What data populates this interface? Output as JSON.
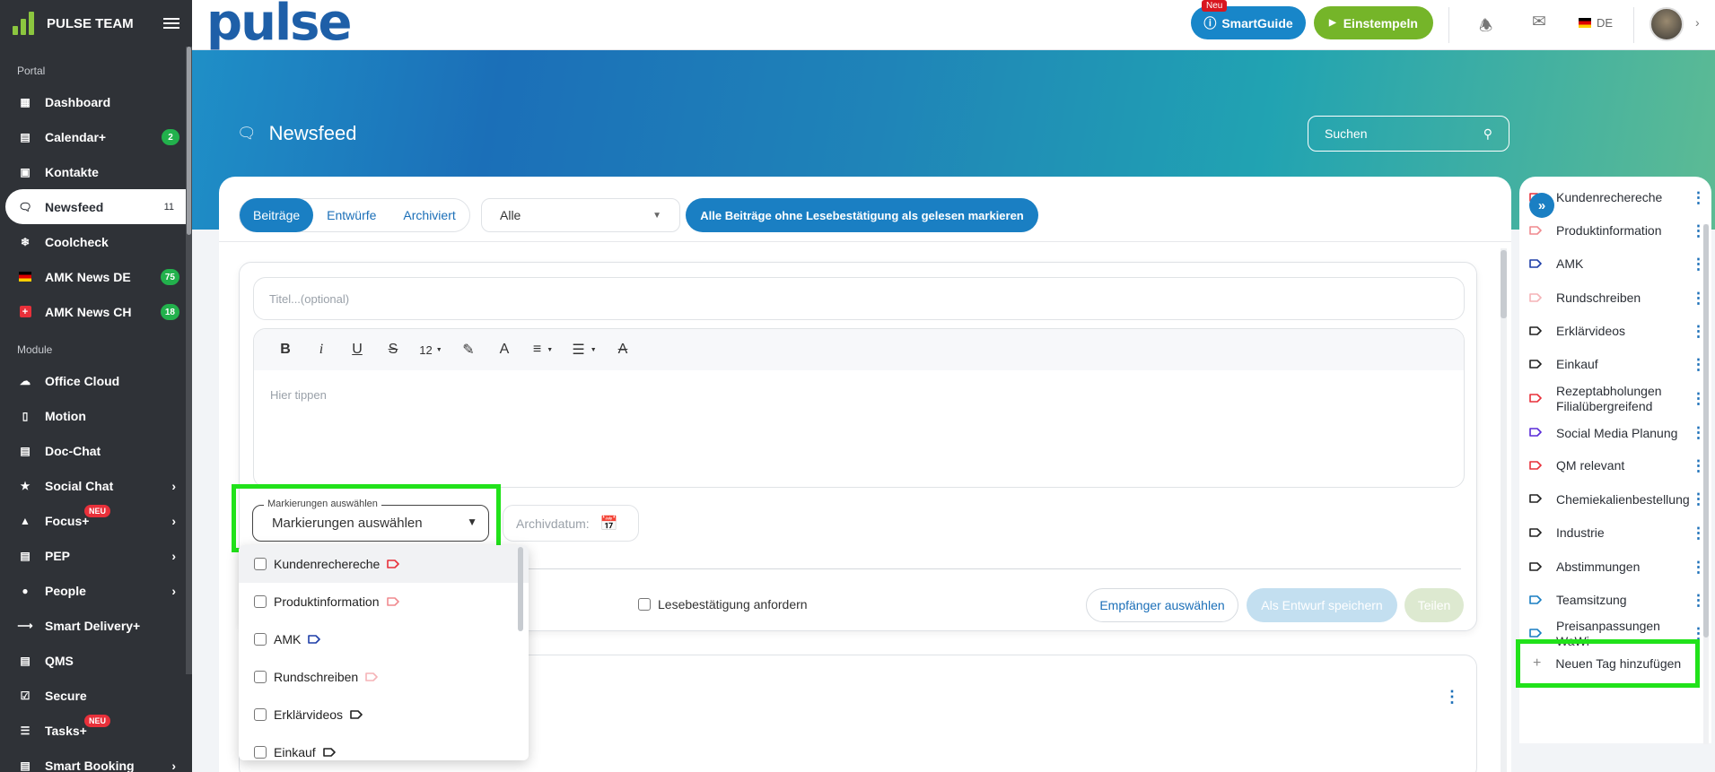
{
  "sidebar": {
    "title": "PULSE TEAM",
    "section_portal": "Portal",
    "section_module": "Module",
    "items_portal": [
      {
        "label": "Dashboard",
        "icon": "dashboard-icon"
      },
      {
        "label": "Calendar+",
        "icon": "calendar-icon",
        "badge": "2"
      },
      {
        "label": "Kontakte",
        "icon": "contacts-icon"
      },
      {
        "label": "Newsfeed",
        "icon": "newsfeed-icon",
        "count": "11",
        "active": true
      },
      {
        "label": "Coolcheck",
        "icon": "snowflake-icon"
      },
      {
        "label": "AMK News DE",
        "icon": "flag-de-icon",
        "badge": "75"
      },
      {
        "label": "AMK News CH",
        "icon": "flag-ch-icon",
        "badge": "18"
      }
    ],
    "items_module": [
      {
        "label": "Office Cloud",
        "icon": "cloud-icon"
      },
      {
        "label": "Motion",
        "icon": "phone-icon"
      },
      {
        "label": "Doc-Chat",
        "icon": "chat-icon"
      },
      {
        "label": "Social Chat",
        "icon": "share-icon",
        "chevron": true
      },
      {
        "label": "Focus+",
        "icon": "graduation-icon",
        "chevron": true,
        "neu": "NEU"
      },
      {
        "label": "PEP",
        "icon": "clipboard-icon",
        "chevron": true
      },
      {
        "label": "People",
        "icon": "people-icon",
        "chevron": true
      },
      {
        "label": "Smart Delivery+",
        "icon": "arrow-right-icon"
      },
      {
        "label": "QMS",
        "icon": "qms-icon"
      },
      {
        "label": "Secure",
        "icon": "check-square-icon"
      },
      {
        "label": "Tasks+",
        "icon": "list-icon",
        "neu": "NEU"
      },
      {
        "label": "Smart Booking",
        "icon": "booking-icon",
        "chevron": true
      }
    ]
  },
  "topbar": {
    "brand": "pulse",
    "smartguide": "SmartGuide",
    "neu": "Neu",
    "einstempeln": "Einstempeln",
    "lang": "DE"
  },
  "hero": {
    "title": "Newsfeed",
    "search_placeholder": "Suchen"
  },
  "main": {
    "tabs": [
      "Beiträge",
      "Entwürfe",
      "Archiviert"
    ],
    "filter_value": "Alle",
    "mark_read_button": "Alle Beiträge ohne Lesebestätigung als gelesen markieren",
    "title_placeholder": "Titel...(optional)",
    "font_size": "12",
    "editor_placeholder": "Hier tippen",
    "tag_select_label": "Markierungen auswählen",
    "tag_select_value": "Markierungen auswählen",
    "archive_label": "Archivdatum:",
    "read_receipt": "Lesebestätigung anfordern",
    "recipients_button": "Empfänger auswählen",
    "draft_button": "Als Entwurf speichern",
    "share_button": "Teilen"
  },
  "dropdown": [
    {
      "label": "Kundenrechereche",
      "color": "#e8303a"
    },
    {
      "label": "Produktinformation",
      "color": "#f08a8f"
    },
    {
      "label": "AMK",
      "color": "#1e3fa8"
    },
    {
      "label": "Rundschreiben",
      "color": "#f5b3b7"
    },
    {
      "label": "Erklärvideos",
      "color": "#222222"
    },
    {
      "label": "Einkauf",
      "color": "#222222"
    }
  ],
  "right_panel": {
    "tags": [
      {
        "label": "Kundenrechereche",
        "color": "#e8303a"
      },
      {
        "label": "Produktinformation",
        "color": "#f08a8f"
      },
      {
        "label": "AMK",
        "color": "#1e3fa8"
      },
      {
        "label": "Rundschreiben",
        "color": "#f5b3b7"
      },
      {
        "label": "Erklärvideos",
        "color": "#222222"
      },
      {
        "label": "Einkauf",
        "color": "#222222"
      },
      {
        "label": "Rezeptabholungen Filialübergreifend",
        "color": "#e8303a"
      },
      {
        "label": "Social Media Planung",
        "color": "#5a2bd8"
      },
      {
        "label": "QM relevant",
        "color": "#e8303a"
      },
      {
        "label": "Chemiekalienbestellung",
        "color": "#222222"
      },
      {
        "label": "Industrie",
        "color": "#222222"
      },
      {
        "label": "Abstimmungen",
        "color": "#222222"
      },
      {
        "label": "Teamsitzung",
        "color": "#1a7fc3"
      },
      {
        "label": "Preisanpassungen WaWi",
        "color": "#1a7fc3"
      }
    ],
    "add_tag": "Neuen Tag hinzufügen"
  }
}
